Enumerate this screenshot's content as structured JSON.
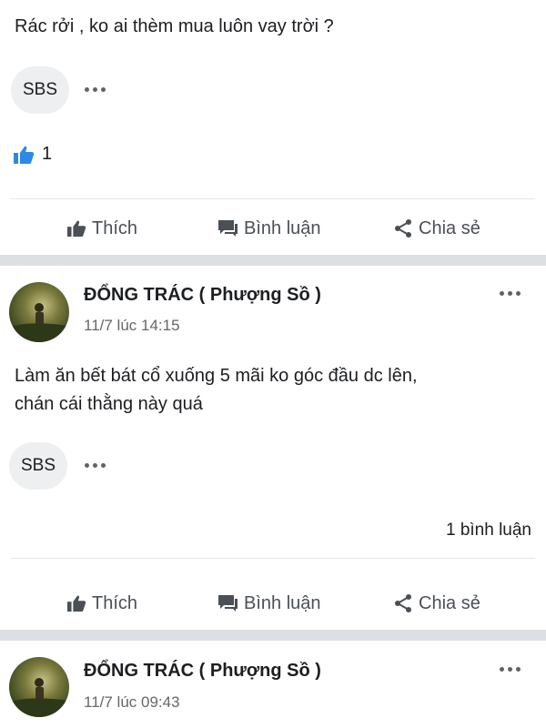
{
  "post1": {
    "text": "Rác rởi , ko ai thèm mua luôn vay trời ?",
    "tag": "SBS",
    "like_count": "1"
  },
  "post2": {
    "author": "ĐỔNG TRÁC ( Phượng Sồ )",
    "time": "11/7 lúc 14:15",
    "text_line1": "Làm ăn bết bát cổ xuống 5 mãi ko góc đầu dc lên,",
    "text_line2": "chán cái thằng này quá",
    "tag": "SBS",
    "comments": "1 bình luận"
  },
  "post3": {
    "author": "ĐỔNG TRÁC ( Phượng Sồ )",
    "time": "11/7 lúc 09:43"
  },
  "actions": {
    "like": "Thích",
    "comment": "Bình luận",
    "share": "Chia sẻ"
  },
  "icons": {
    "like": "thumbs-up-icon",
    "comment": "comment-icon",
    "share": "share-icon",
    "more": "more-dots-icon"
  },
  "colors": {
    "like_blue": "#2d88e8",
    "muted": "#65676b",
    "separator": "#dcdfe3"
  }
}
